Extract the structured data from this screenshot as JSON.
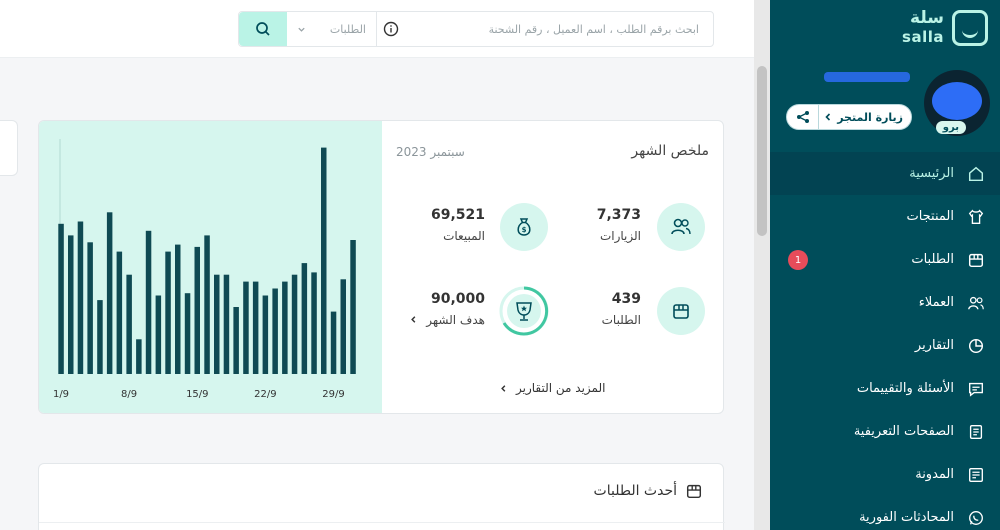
{
  "brand": {
    "name_ar": "سلة",
    "name_en": "salla"
  },
  "store": {
    "plan_badge": "برو",
    "visit_label": "زيارة المتجر"
  },
  "nav": [
    {
      "label": "الرئيسية",
      "icon": "home-icon",
      "active": true
    },
    {
      "label": "المنتجات",
      "icon": "shirt-icon"
    },
    {
      "label": "الطلبات",
      "icon": "orders-icon",
      "count": "1"
    },
    {
      "label": "العملاء",
      "icon": "users-icon"
    },
    {
      "label": "التقارير",
      "icon": "pie-chart-icon"
    },
    {
      "label": "الأسئلة والتقييمات",
      "icon": "comment-icon"
    },
    {
      "label": "الصفحات التعريفية",
      "icon": "page-icon"
    },
    {
      "label": "المدونة",
      "icon": "blog-icon"
    },
    {
      "label": "المحادثات الفورية",
      "icon": "whatsapp-icon"
    }
  ],
  "search": {
    "placeholder": "ابحث برقم الطلب ، اسم العميل ، رقم الشحنة",
    "scope": "الطلبات"
  },
  "summary": {
    "title": "ملخص الشهر",
    "date": "سبتمبر 2023",
    "visits": {
      "value": "7,373",
      "label": "الزيارات"
    },
    "sales": {
      "value": "69,521",
      "label": "المبيعات"
    },
    "orders": {
      "value": "439",
      "label": "الطلبات"
    },
    "goal": {
      "value": "90,000",
      "label": "هدف الشهر"
    },
    "more_link": "المزيد من التقارير"
  },
  "latest_orders": {
    "title": "أحدث الطلبات"
  },
  "chart_data": {
    "type": "bar",
    "x_tick_labels": [
      "1/9",
      "8/9",
      "15/9",
      "22/9",
      "29/9"
    ],
    "values": [
      65,
      60,
      66,
      57,
      32,
      70,
      53,
      43,
      15,
      62,
      34,
      53,
      56,
      35,
      55,
      60,
      43,
      43,
      29,
      40,
      40,
      34,
      37,
      40,
      43,
      48,
      44,
      98,
      27,
      41,
      58
    ],
    "ylim": [
      0,
      100
    ],
    "color": "#0f4a53",
    "background": "#d6f6ee"
  },
  "colors": {
    "sidebar": "#004d5a",
    "accent": "#baf3e6",
    "badge": "#e74c5a"
  }
}
